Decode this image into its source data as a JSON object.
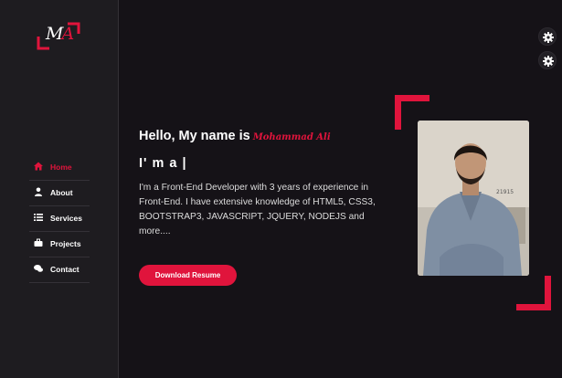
{
  "logo": {
    "m": "M",
    "a": "A"
  },
  "nav": {
    "items": [
      {
        "label": "Home",
        "icon": "home-icon",
        "active": true
      },
      {
        "label": "About",
        "icon": "user-icon"
      },
      {
        "label": "Services",
        "icon": "list-icon"
      },
      {
        "label": "Projects",
        "icon": "briefcase-icon"
      },
      {
        "label": "Contact",
        "icon": "chat-icon"
      }
    ]
  },
  "hero": {
    "greeting": "Hello, My name is",
    "name": "Mohammad Ali",
    "typing": "I' m a |",
    "description": "I'm a Front-End Developer with 3 years of experience in Front-End. I have extensive knowledge of HTML5, CSS3, BOOTSTRAP3, JAVASCRIPT, JQUERY, NODEJS and more....",
    "button": "Download Resume",
    "photo_caption": "21915"
  },
  "colors": {
    "accent": "#e0143c",
    "background": "#151217",
    "sidebar": "#1e1c20"
  }
}
